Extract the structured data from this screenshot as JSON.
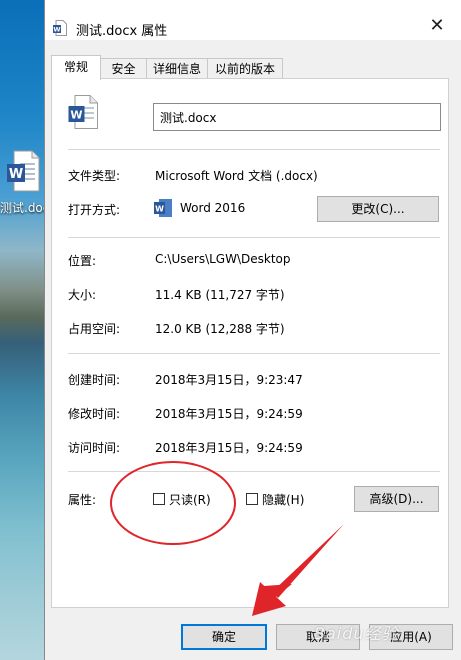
{
  "desktop": {
    "icon_label": "测试.doc"
  },
  "window": {
    "title": "测试.docx 属性",
    "close_glyph": "✕"
  },
  "tabs": [
    {
      "label": "常规"
    },
    {
      "label": "安全"
    },
    {
      "label": "详细信息"
    },
    {
      "label": "以前的版本"
    }
  ],
  "general": {
    "file_name": "测试.docx",
    "file_type_label": "文件类型:",
    "file_type_value": "Microsoft Word 文档 (.docx)",
    "opens_with_label": "打开方式:",
    "opens_with_value": "Word 2016",
    "change_button": "更改(C)...",
    "location_label": "位置:",
    "location_value": "C:\\Users\\LGW\\Desktop",
    "size_label": "大小:",
    "size_value": "11.4 KB (11,727 字节)",
    "size_on_disk_label": "占用空间:",
    "size_on_disk_value": "12.0 KB (12,288 字节)",
    "created_label": "创建时间:",
    "created_value": "2018年3月15日，9:23:47",
    "modified_label": "修改时间:",
    "modified_value": "2018年3月15日，9:24:59",
    "accessed_label": "访问时间:",
    "accessed_value": "2018年3月15日，9:24:59",
    "attributes_label": "属性:",
    "readonly_label": "只读(R)",
    "hidden_label": "隐藏(H)",
    "advanced_button": "高级(D)..."
  },
  "footer": {
    "ok_button": "确定",
    "cancel_button": "取消",
    "apply_button": "应用(A)"
  },
  "watermark": {
    "text": "Baidu经验"
  },
  "colors": {
    "accent": "#0078d7",
    "annotation_red": "#e0252a",
    "word_blue": "#2b579a"
  }
}
